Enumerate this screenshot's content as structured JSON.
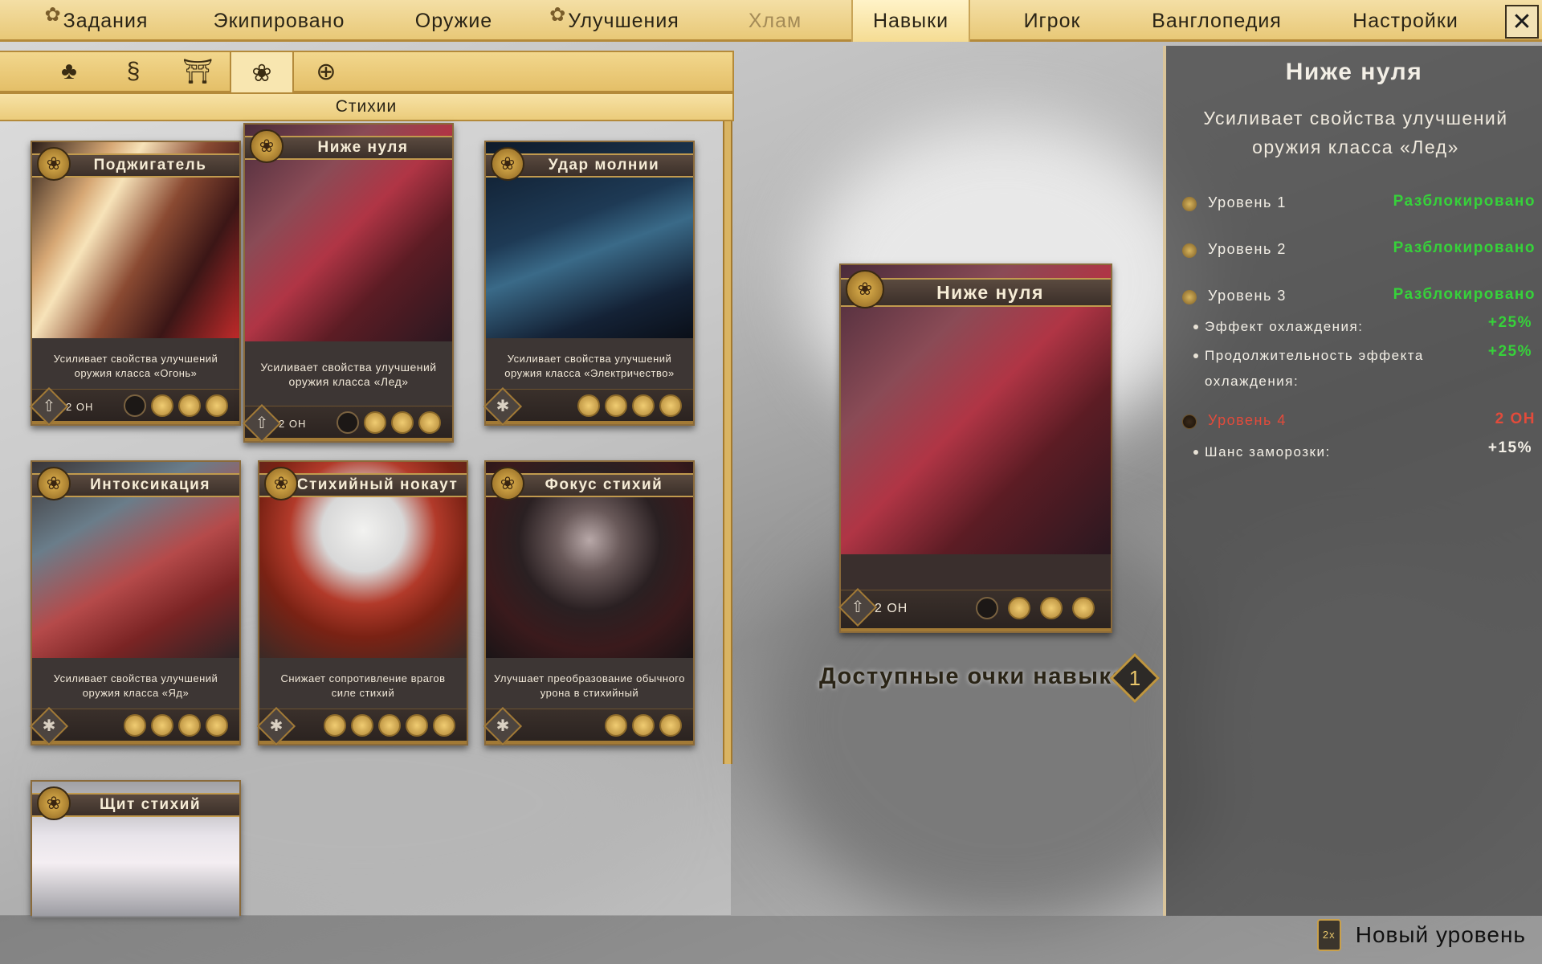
{
  "nav": {
    "tabs": [
      {
        "label": "Задания",
        "state": "normal",
        "badge_icon": "gear-icon"
      },
      {
        "label": "Экипировано",
        "state": "normal"
      },
      {
        "label": "Оружие",
        "state": "normal"
      },
      {
        "label": "Улучшения",
        "state": "normal",
        "badge_icon": "gear-icon"
      },
      {
        "label": "Хлам",
        "state": "disabled"
      },
      {
        "label": "Навыки",
        "state": "active"
      },
      {
        "label": "Игрок",
        "state": "normal"
      },
      {
        "label": "Ванглопедия",
        "state": "normal"
      },
      {
        "label": "Настройки",
        "state": "normal"
      }
    ],
    "close_symbol": "✕"
  },
  "categories": {
    "icons": [
      "bonsai-icon",
      "dragon-icon",
      "torii-icon",
      "lotus-icon",
      "lantern-icon"
    ],
    "active_index": 3,
    "subtitle": "Стихии"
  },
  "cards": [
    {
      "title": "Поджигатель",
      "desc": "Усиливает свойства улучшений оружия класса «Огонь»",
      "cost": "2 ОН",
      "filled": 3,
      "empty": 1,
      "icon": "upgrade-arrow-icon"
    },
    {
      "title": "Ниже нуля",
      "desc": "Усиливает свойства улучшений оружия класса «Лед»",
      "cost": "2 ОН",
      "filled": 3,
      "empty": 1,
      "icon": "upgrade-arrow-icon"
    },
    {
      "title": "Удар молнии",
      "desc": "Усиливает свойства улучшений оружия класса «Электричество»",
      "cost": "",
      "filled": 4,
      "empty": 0,
      "icon": "star-burst-icon"
    },
    {
      "title": "Интоксикация",
      "desc": "Усиливает свойства улучшений оружия класса «Яд»",
      "cost": "",
      "filled": 4,
      "empty": 0,
      "icon": "star-burst-icon"
    },
    {
      "title": "Стихийный нокаут",
      "desc": "Снижает сопротивление врагов силе стихий",
      "cost": "",
      "filled": 5,
      "empty": 0,
      "icon": "star-burst-icon"
    },
    {
      "title": "Фокус стихий",
      "desc": "Улучшает преобразование обычного урона в стихийный",
      "cost": "",
      "filled": 3,
      "empty": 0,
      "icon": "star-burst-icon"
    },
    {
      "title": "Щит стихий",
      "desc": "",
      "cost": "",
      "filled": 0,
      "empty": 0,
      "icon": ""
    }
  ],
  "detail": {
    "title": "Ниже нуля",
    "cost": "2 ОН",
    "filled": 3,
    "empty": 1
  },
  "skill_points": {
    "label": "Доступные очки навыков",
    "value": "1"
  },
  "info": {
    "title": "Ниже нуля",
    "desc": "Усиливает свойства улучшений оружия класса «Лед»",
    "levels": [
      {
        "label": "Уровень 1",
        "value": "Разблокировано",
        "state": "unlocked"
      },
      {
        "label": "Уровень 2",
        "value": "Разблокировано",
        "state": "unlocked"
      },
      {
        "label": "Уровень 3",
        "value": "Разблокировано",
        "state": "unlocked"
      },
      {
        "label": "Уровень 4",
        "value": "2 ОН",
        "state": "locked"
      }
    ],
    "level3_effects": [
      {
        "label": "Эффект охлаждения:",
        "value": "+25%"
      },
      {
        "label": "Продолжительность эффекта охлаждения:",
        "value": "+25%"
      }
    ],
    "level4_effects": [
      {
        "label": "Шанс заморозки:",
        "value": "+15%"
      }
    ]
  },
  "bottom": {
    "new_level": "Новый уровень",
    "multiplier": "2x"
  },
  "colors": {
    "accent_gold": "#e8c877",
    "unlocked_green": "#36d23a",
    "locked_red": "#e24b3b"
  }
}
